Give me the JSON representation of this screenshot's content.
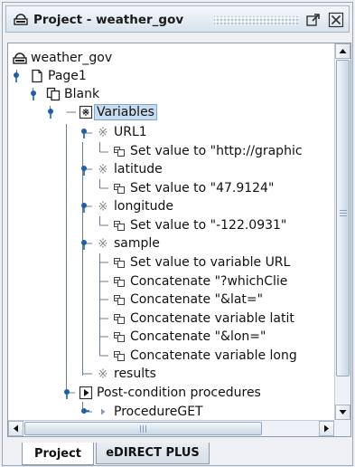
{
  "window": {
    "title": "Project - weather_gov"
  },
  "tree": {
    "items": [
      {
        "label": "weather_gov",
        "icon": "project-icon"
      },
      {
        "label": "Page1",
        "icon": "page-icon"
      },
      {
        "label": "Blank",
        "icon": "blank-page-icon"
      },
      {
        "label": "Variables",
        "icon": "variables-icon",
        "selected": true
      },
      {
        "label": "URL1",
        "icon": "variable-icon"
      },
      {
        "label": "Set value to \"http://graphic",
        "icon": "action-icon"
      },
      {
        "label": "latitude",
        "icon": "variable-icon"
      },
      {
        "label": "Set value to \"47.9124\"",
        "icon": "action-icon"
      },
      {
        "label": "longitude",
        "icon": "variable-icon"
      },
      {
        "label": "Set value to \"-122.0931\"",
        "icon": "action-icon"
      },
      {
        "label": "sample",
        "icon": "variable-icon"
      },
      {
        "label": "Set value to variable URL",
        "icon": "action-icon"
      },
      {
        "label": "Concatenate \"?whichClie",
        "icon": "action-icon"
      },
      {
        "label": "Concatenate \"&lat=\"",
        "icon": "action-icon"
      },
      {
        "label": "Concatenate variable latit",
        "icon": "action-icon"
      },
      {
        "label": "Concatenate \"&lon=\"",
        "icon": "action-icon"
      },
      {
        "label": "Concatenate variable long",
        "icon": "action-icon"
      },
      {
        "label": "results",
        "icon": "variable-icon"
      },
      {
        "label": "Post-condition procedures",
        "icon": "procedures-icon"
      },
      {
        "label": "ProcedureGET",
        "icon": "procedure-icon"
      }
    ]
  },
  "tabs": [
    {
      "label": "Project",
      "active": true
    },
    {
      "label": "eDIRECT PLUS",
      "active": false
    }
  ]
}
